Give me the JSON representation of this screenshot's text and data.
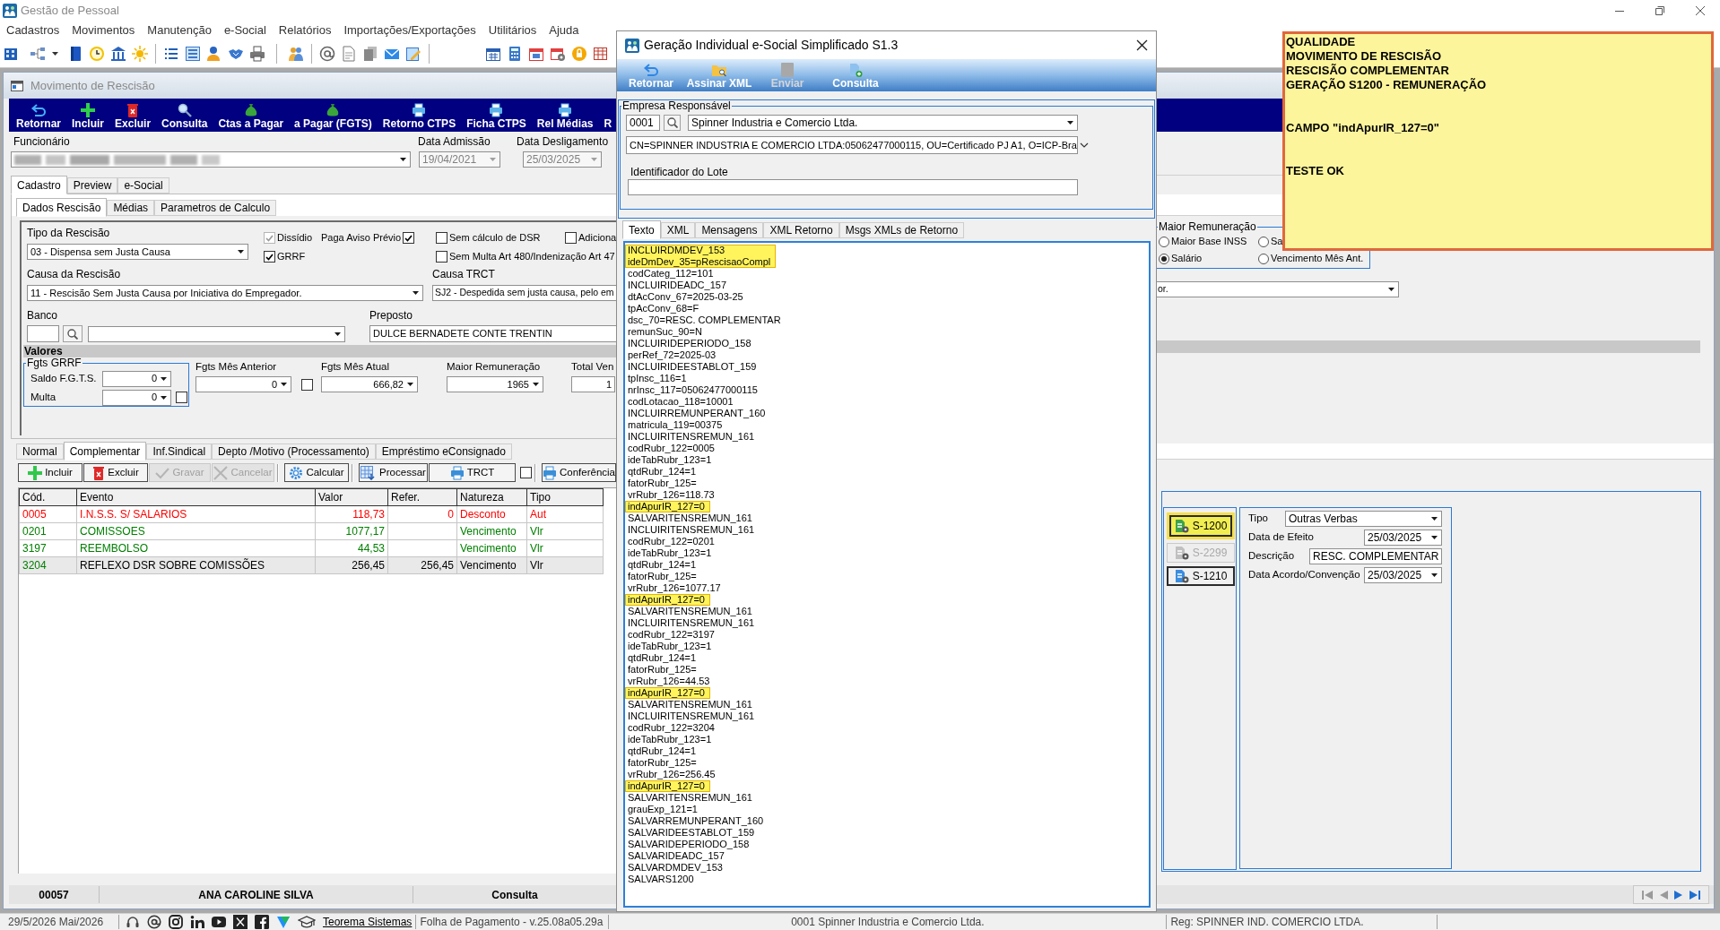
{
  "app": {
    "title": "Gestão de Pessoal",
    "menu": [
      "Cadastros",
      "Movimentos",
      "Manutenção",
      "e-Social",
      "Relatórios",
      "Importações/Exportações",
      "Utilitários",
      "Ajuda"
    ]
  },
  "rescisao_window": {
    "title": "Movimento de Rescisão",
    "actions": [
      "Retornar",
      "Incluir",
      "Excluir",
      "Consulta",
      "Ctas a Pagar",
      "a Pagar (FGTS)",
      "Retorno CTPS",
      "Ficha CTPS",
      "Rel Médias",
      "R"
    ],
    "employee_label": "Funcionário",
    "admission": {
      "label": "Data Admissão",
      "value": "19/04/2021",
      "disabled": true
    },
    "dismissal": {
      "label": "Data Desligamento",
      "value": "25/03/2025",
      "disabled": true
    },
    "tabs": [
      {
        "label": "Cadastro",
        "selected": true
      },
      {
        "label": "Preview",
        "selected": false
      },
      {
        "label": "e-Social",
        "selected": false
      }
    ],
    "subtabs": [
      {
        "label": "Dados Rescisão",
        "selected": true
      },
      {
        "label": "Médias",
        "selected": false
      },
      {
        "label": "Parametros de Calculo",
        "selected": false
      }
    ],
    "form": {
      "tipo_rescisao": {
        "label": "Tipo da Rescisão",
        "value": "03 - Dispensa sem Justa Causa"
      },
      "options": [
        [
          {
            "kind": "box_first",
            "label": "Dissídio",
            "checked": true,
            "disabled": true
          },
          {
            "kind": "box_first",
            "label": "GRRF",
            "checked": true,
            "disabled": false
          }
        ],
        [
          {
            "kind": "label_first",
            "label": "Paga Aviso Prévio",
            "checked": true,
            "disabled": false
          }
        ],
        [
          {
            "kind": "box_first",
            "label": "Sem cálculo de DSR",
            "checked": false,
            "disabled": false
          },
          {
            "kind": "box_first",
            "label": "Sem Multa Art 480/Indenização Art 47",
            "checked": false,
            "disabled": false
          }
        ],
        [
          {
            "kind": "box_first",
            "label": "Adiciona",
            "checked": false,
            "disabled": false
          }
        ]
      ],
      "causa_rescisao": {
        "label": "Causa da Rescisão",
        "value": "11 - Rescisão Sem Justa Causa por Iniciativa do Empregador."
      },
      "causa_trct": {
        "label": "Causa TRCT",
        "value": "SJ2 - Despedida sem justa causa, pelo em",
        "value_tail": "or."
      },
      "banco": {
        "label": "Banco"
      },
      "preposto": {
        "label": "Preposto",
        "value": "DULCE BERNADETE CONTE TRENTIN"
      },
      "valores": {
        "title": "Valores",
        "fgts_grrf": {
          "title": "Fgts GRRF",
          "saldo": {
            "label": "Saldo F.G.T.S.",
            "value": "0"
          },
          "multa": {
            "label": "Multa",
            "value": "0",
            "checked": false
          }
        },
        "fields": [
          {
            "label": "Fgts Mês Anterior",
            "value": "0",
            "checked": false
          },
          {
            "label": "Fgts Mês Atual",
            "value": "666,82"
          },
          {
            "label": "Maior Remuneração",
            "value": "1965"
          },
          {
            "label": "Total Ven",
            "value": "1"
          }
        ]
      },
      "maior_remuneracao": {
        "title": "Maior Remuneração",
        "options": [
          {
            "label": "Maior Base INSS",
            "selected": false
          },
          {
            "label": "Sa",
            "selected": false
          },
          {
            "label": "Salário",
            "selected": true
          },
          {
            "label": "Vencimento Mês Ant.",
            "selected": false
          }
        ]
      }
    },
    "lower_tabs": [
      {
        "label": "Normal",
        "selected": false
      },
      {
        "label": "Complementar",
        "selected": true
      },
      {
        "label": "Inf.Sindical",
        "selected": false
      },
      {
        "label": "Depto /Motivo (Processamento)",
        "selected": false
      },
      {
        "label": "Empréstimo eConsignado",
        "selected": false
      }
    ],
    "toolbar": [
      {
        "kind": "button",
        "label": "Incluir",
        "disabled": false
      },
      {
        "kind": "button",
        "label": "Excluir",
        "disabled": false
      },
      {
        "kind": "button",
        "label": "Gravar",
        "disabled": true
      },
      {
        "kind": "button",
        "label": "Cancelar",
        "disabled": true
      },
      {
        "kind": "separator"
      },
      {
        "kind": "button",
        "label": "Calcular",
        "disabled": false
      },
      {
        "kind": "separator"
      },
      {
        "kind": "button",
        "label": "Processar",
        "disabled": false
      },
      {
        "kind": "button",
        "label": "TRCT",
        "disabled": false
      },
      {
        "kind": "checkbox",
        "checked": false
      },
      {
        "kind": "separator"
      },
      {
        "kind": "button",
        "label": "Conferência",
        "disabled": false
      }
    ],
    "table": {
      "columns": [
        "Cód.",
        "Evento",
        "Valor",
        "Refer.",
        "Natureza",
        "Tipo"
      ],
      "rows": [
        {
          "cells": [
            "0005",
            "I.N.S.S. S/ SALARIOS",
            "118,73",
            "0",
            "Desconto",
            "Aut"
          ],
          "color": "#ff0000",
          "selected": false
        },
        {
          "cells": [
            "0201",
            "COMISSOES",
            "1077,17",
            "",
            "Vencimento",
            "Vlr"
          ],
          "color": "#008000",
          "selected": false
        },
        {
          "cells": [
            "3197",
            "REEMBOLSO",
            "44,53",
            "",
            "Vencimento",
            "Vlr"
          ],
          "color": "#008000",
          "selected": false
        },
        {
          "cells": [
            "3204",
            "REFLEXO DSR SOBRE COMISSÕES",
            "256,45",
            "256,45",
            "Vencimento",
            "Vlr"
          ],
          "color": "#008000",
          "selected": true
        }
      ]
    },
    "events_panel": {
      "buttons": [
        {
          "label": "S-1200",
          "highlighted": true,
          "disabled": false
        },
        {
          "label": "S-2299",
          "highlighted": false,
          "disabled": true
        },
        {
          "label": "S-1210",
          "highlighted": false,
          "disabled": false
        }
      ],
      "fields": [
        {
          "kind": "select",
          "label": "Tipo",
          "value": "Outras Verbas"
        },
        {
          "kind": "date",
          "label": "Data de Efeito",
          "value": "25/03/2025"
        },
        {
          "kind": "text",
          "label": "Descrição",
          "value": "RESC. COMPLEMENTAR"
        },
        {
          "kind": "date",
          "label": "Data Acordo/Convenção",
          "value": "25/03/2025"
        }
      ]
    },
    "footer": {
      "code": "00057",
      "name": "ANA CAROLINE SILVA",
      "mode": "Consulta"
    }
  },
  "dialog": {
    "title": "Geração Individual e-Social Simplificado S1.3",
    "toolbar": [
      {
        "label": "Retornar",
        "disabled": false
      },
      {
        "label": "Assinar XML",
        "disabled": false
      },
      {
        "label": "Enviar",
        "disabled": true
      },
      {
        "label": "Consulta",
        "disabled": false
      }
    ],
    "group_title": "Empresa Responsável",
    "company_code": "0001",
    "company": "Spinner Industria e Comercio Ltda.",
    "certificate": "CN=SPINNER INDUSTRIA E COMERCIO LTDA:05062477000115, OU=Certificado PJ A1, O=ICP-Bra",
    "batch_label": "Identificador do Lote",
    "tabs": [
      {
        "label": "Texto",
        "selected": true
      },
      {
        "label": "XML",
        "selected": false
      },
      {
        "label": "Mensagens",
        "selected": false
      },
      {
        "label": "XML Retorno",
        "selected": false
      },
      {
        "label": "Msgs XMLs de Retorno",
        "selected": false
      }
    ],
    "lines": [
      {
        "text": "INCLUIRDMDEV_153",
        "highlighted": true
      },
      {
        "text": "ideDmDev_35=pRescisaoCompl",
        "highlighted": true
      },
      {
        "text": "codCateg_112=101",
        "highlighted": false
      },
      {
        "text": "INCLUIRIDEADC_157",
        "highlighted": false
      },
      {
        "text": "dtAcConv_67=2025-03-25",
        "highlighted": false
      },
      {
        "text": "tpAcConv_68=F",
        "highlighted": false
      },
      {
        "text": "dsc_70=RESC. COMPLEMENTAR",
        "highlighted": false
      },
      {
        "text": "remunSuc_90=N",
        "highlighted": false
      },
      {
        "text": "INCLUIRIDEPERIODO_158",
        "highlighted": false
      },
      {
        "text": "perRef_72=2025-03",
        "highlighted": false
      },
      {
        "text": "INCLUIRIDEESTABLOT_159",
        "highlighted": false
      },
      {
        "text": "tpInsc_116=1",
        "highlighted": false
      },
      {
        "text": "nrInsc_117=05062477000115",
        "highlighted": false
      },
      {
        "text": "codLotacao_118=10001",
        "highlighted": false
      },
      {
        "text": "INCLUIRREMUNPERANT_160",
        "highlighted": false
      },
      {
        "text": "matricula_119=00375",
        "highlighted": false
      },
      {
        "text": "INCLUIRITENSREMUN_161",
        "highlighted": false
      },
      {
        "text": "codRubr_122=0005",
        "highlighted": false
      },
      {
        "text": "ideTabRubr_123=1",
        "highlighted": false
      },
      {
        "text": "qtdRubr_124=1",
        "highlighted": false
      },
      {
        "text": "fatorRubr_125=",
        "highlighted": false
      },
      {
        "text": "vrRubr_126=118.73",
        "highlighted": false
      },
      {
        "text": "indApurIR_127=0",
        "highlighted": true
      },
      {
        "text": "SALVARITENSREMUN_161",
        "highlighted": false
      },
      {
        "text": "INCLUIRITENSREMUN_161",
        "highlighted": false
      },
      {
        "text": "codRubr_122=0201",
        "highlighted": false
      },
      {
        "text": "ideTabRubr_123=1",
        "highlighted": false
      },
      {
        "text": "qtdRubr_124=1",
        "highlighted": false
      },
      {
        "text": "fatorRubr_125=",
        "highlighted": false
      },
      {
        "text": "vrRubr_126=1077.17",
        "highlighted": false
      },
      {
        "text": "indApurIR_127=0",
        "highlighted": true
      },
      {
        "text": "SALVARITENSREMUN_161",
        "highlighted": false
      },
      {
        "text": "INCLUIRITENSREMUN_161",
        "highlighted": false
      },
      {
        "text": "codRubr_122=3197",
        "highlighted": false
      },
      {
        "text": "ideTabRubr_123=1",
        "highlighted": false
      },
      {
        "text": "qtdRubr_124=1",
        "highlighted": false
      },
      {
        "text": "fatorRubr_125=",
        "highlighted": false
      },
      {
        "text": "vrRubr_126=44.53",
        "highlighted": false
      },
      {
        "text": "indApurIR_127=0",
        "highlighted": true
      },
      {
        "text": "SALVARITENSREMUN_161",
        "highlighted": false
      },
      {
        "text": "INCLUIRITENSREMUN_161",
        "highlighted": false
      },
      {
        "text": "codRubr_122=3204",
        "highlighted": false
      },
      {
        "text": "ideTabRubr_123=1",
        "highlighted": false
      },
      {
        "text": "qtdRubr_124=1",
        "highlighted": false
      },
      {
        "text": "fatorRubr_125=",
        "highlighted": false
      },
      {
        "text": "vrRubr_126=256.45",
        "highlighted": false
      },
      {
        "text": "indApurIR_127=0",
        "highlighted": true
      },
      {
        "text": "SALVARITENSREMUN_161",
        "highlighted": false
      },
      {
        "text": "grauExp_121=1",
        "highlighted": false
      },
      {
        "text": "SALVARREMUNPERANT_160",
        "highlighted": false
      },
      {
        "text": "SALVARIDEESTABLOT_159",
        "highlighted": false
      },
      {
        "text": "SALVARIDEPERIODO_158",
        "highlighted": false
      },
      {
        "text": "SALVARIDEADC_157",
        "highlighted": false
      },
      {
        "text": "SALVARDMDEV_153",
        "highlighted": false
      },
      {
        "text": "SALVARS1200",
        "highlighted": false
      }
    ]
  },
  "note": {
    "blocks": [
      [
        "QUALIDADE",
        "MOVIMENTO DE RESCISÃO",
        "RESCISÃO COMPLEMENTAR",
        "GERAÇÃO S1200 - REMUNERAÇÃO"
      ],
      [
        "CAMPO \"indApurIR_127=0\""
      ],
      [
        "TESTE OK"
      ]
    ]
  },
  "status_bar": {
    "date": "29/5/2026 Mai/2026",
    "link": "Teorema Sistemas",
    "version": "Folha de Pagamento - v.25.08a05.29a",
    "company": "0001 Spinner Industria e Comercio Ltda.",
    "registration": "Reg: SPINNER IND. COMERCIO LTDA."
  }
}
